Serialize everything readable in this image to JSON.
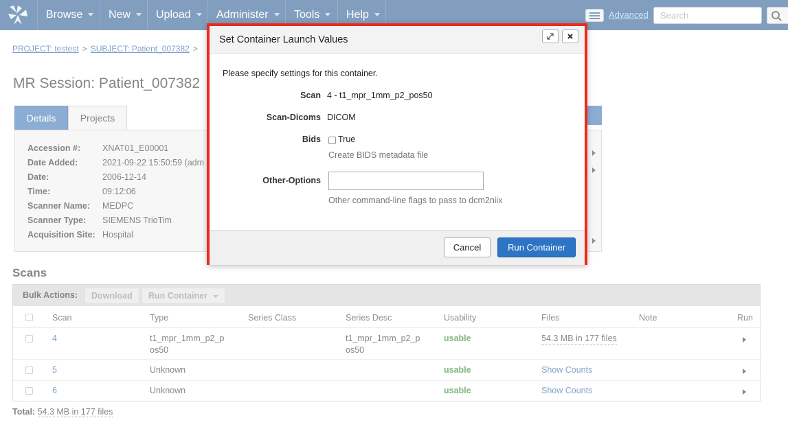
{
  "nav": {
    "items": [
      {
        "label": "Browse"
      },
      {
        "label": "New"
      },
      {
        "label": "Upload"
      },
      {
        "label": "Administer"
      },
      {
        "label": "Tools"
      },
      {
        "label": "Help"
      }
    ],
    "advanced_link": "Advanced",
    "search_placeholder": "Search",
    "accent_color": "#1b4f8a"
  },
  "breadcrumb": {
    "project": "PROJECT: testest",
    "subject": "SUBJECT: Patient_007382",
    "sep": ">"
  },
  "page_title": "MR Session: Patient_007382",
  "tabs": {
    "details": "Details",
    "projects": "Projects"
  },
  "details": [
    {
      "label": "Accession #:",
      "value": "XNAT01_E00001"
    },
    {
      "label": "Date Added:",
      "value": "2021-09-22 15:50:59 (adm"
    },
    {
      "label": "Date:",
      "value": "2006-12-14"
    },
    {
      "label": "Time:",
      "value": "09:12:06"
    },
    {
      "label": "Scanner Name:",
      "value": "MEDPC"
    },
    {
      "label": "Scanner Type:",
      "value": "SIEMENS TrioTim"
    },
    {
      "label": "Acquisition Site:",
      "value": "Hospital"
    }
  ],
  "scans": {
    "title": "Scans",
    "bulk_label": "Bulk Actions:",
    "download_button": "Download",
    "run_container_button": "Run Container",
    "columns": [
      "Scan",
      "Type",
      "Series Class",
      "Series Desc",
      "Usability",
      "Files",
      "Note",
      "Run"
    ],
    "rows": [
      {
        "scan": "4",
        "type_line1": "t1_mpr_1mm_p2_p",
        "type_line2": "os50",
        "series_class": "",
        "desc_line1": "t1_mpr_1mm_p2_p",
        "desc_line2": "os50",
        "usability": "usable",
        "files": "54.3 MB in 177 files"
      },
      {
        "scan": "5",
        "type_line1": "Unknown",
        "type_line2": "",
        "series_class": "",
        "desc_line1": "",
        "desc_line2": "",
        "usability": "usable",
        "files": "Show Counts"
      },
      {
        "scan": "6",
        "type_line1": "Unknown",
        "type_line2": "",
        "series_class": "",
        "desc_line1": "",
        "desc_line2": "",
        "usability": "usable",
        "files": "Show Counts"
      }
    ],
    "total_label": "Total:",
    "total_value": "54.3 MB in 177 files"
  },
  "modal": {
    "title": "Set Container Launch Values",
    "intro": "Please specify settings for this container.",
    "scan_label": "Scan",
    "scan_value": "4 - t1_mpr_1mm_p2_pos50",
    "scan_dicoms_label": "Scan-Dicoms",
    "scan_dicoms_value": "DICOM",
    "bids_label": "Bids",
    "bids_checkbox_label": "True",
    "bids_checked": false,
    "bids_help": "Create BIDS metadata file",
    "other_options_label": "Other-Options",
    "other_options_value": "",
    "other_options_help": "Other command-line flags to pass to dcm2niix",
    "cancel_button": "Cancel",
    "run_button": "Run Container",
    "highlight_color": "#ee2a1c",
    "primary_color": "#2d74c4"
  }
}
